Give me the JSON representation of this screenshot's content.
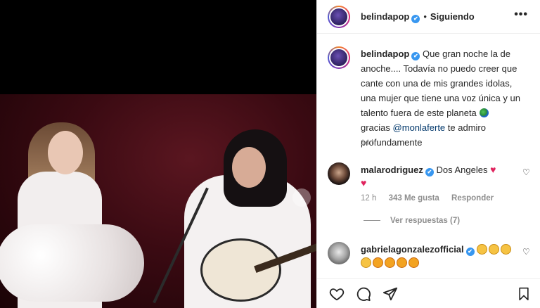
{
  "post": {
    "username": "belindapop",
    "follow_status": "Siguiendo",
    "separator": "•",
    "more_label": "•••",
    "caption_text": "Que gran noche la de anoche.... Todavía no puedo creer que cante con una de mis grandes idolas, una mujer que tiene una voz única y un talento fuera de este planeta",
    "caption_thanks": "gracias",
    "caption_mention": "@monlaferte",
    "caption_end": "te admiro profundamente",
    "time": "14 h",
    "carousel_next": "›"
  },
  "comments": [
    {
      "username": "malarodriguez",
      "text": "Dos Angeles",
      "time": "12 h",
      "likes": "343 Me gusta",
      "reply_label": "Responder",
      "view_replies": "Ver respuestas (7)"
    },
    {
      "username": "gabrielagonzalezofficial"
    }
  ],
  "icons": {
    "verified": "✔",
    "heart": "♥",
    "heart_outline": "♡"
  },
  "colors": {
    "accent_blue": "#3897f0",
    "mention": "#00376b",
    "heart": "#e0245e",
    "muted": "#8e8e8e"
  }
}
